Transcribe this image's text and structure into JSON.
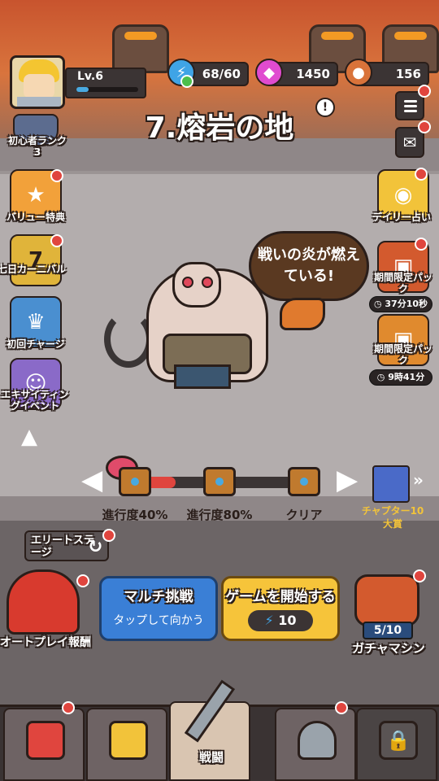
{
  "player": {
    "level_label": "Lv.6",
    "rank_label": "初心者ランク",
    "rank_value": "3",
    "exp_progress": 0.2
  },
  "resources": {
    "stamina": "68/60",
    "gems": "1450",
    "coins": "156"
  },
  "stage": {
    "title": "7.熔岩の地",
    "boss_speech": "戦いの炎が燃えている!"
  },
  "left_events": [
    {
      "label": "バリュー特典",
      "icon": "value-badge-icon"
    },
    {
      "label": "七日カーニバル",
      "icon": "seven-day-icon",
      "badge": "7"
    },
    {
      "label": "初回チャージ",
      "icon": "first-charge-icon"
    },
    {
      "label": "エキサイティングイベント",
      "icon": "exciting-event-icon"
    }
  ],
  "right_events": [
    {
      "label": "デイリー占い",
      "icon": "crystal-ball-icon"
    },
    {
      "label": "期間限定パック",
      "icon": "limited-pack-icon",
      "timer": "37分10秒"
    },
    {
      "label": "期間限定パック",
      "icon": "limited-pack-icon",
      "timer": "9時41分"
    }
  ],
  "progress": {
    "milestones": [
      "進行度40%",
      "進行度80%",
      "クリア"
    ],
    "chapter_reward_label": "チャプター10大賞",
    "value": 0.2
  },
  "elite_stage": "エリートステージ",
  "auto_play": "オートプレイ報酬",
  "multi": {
    "title": "マルチ挑戦",
    "subtitle": "タップして向かう"
  },
  "start": {
    "title": "ゲームを開始する",
    "cost": "10"
  },
  "gacha": {
    "label": "ガチャマシン",
    "count": "5/10"
  },
  "tabs": [
    {
      "name": "shop",
      "label": ""
    },
    {
      "name": "cards",
      "label": ""
    },
    {
      "name": "battle",
      "label": "戦闘"
    },
    {
      "name": "equipment",
      "label": ""
    },
    {
      "name": "locked",
      "label": ""
    }
  ],
  "colors": {
    "accent_blue": "#3a7fd6",
    "accent_yellow": "#f6c43a",
    "gem_pink": "#e04bd0",
    "notification_red": "#e0453e"
  }
}
